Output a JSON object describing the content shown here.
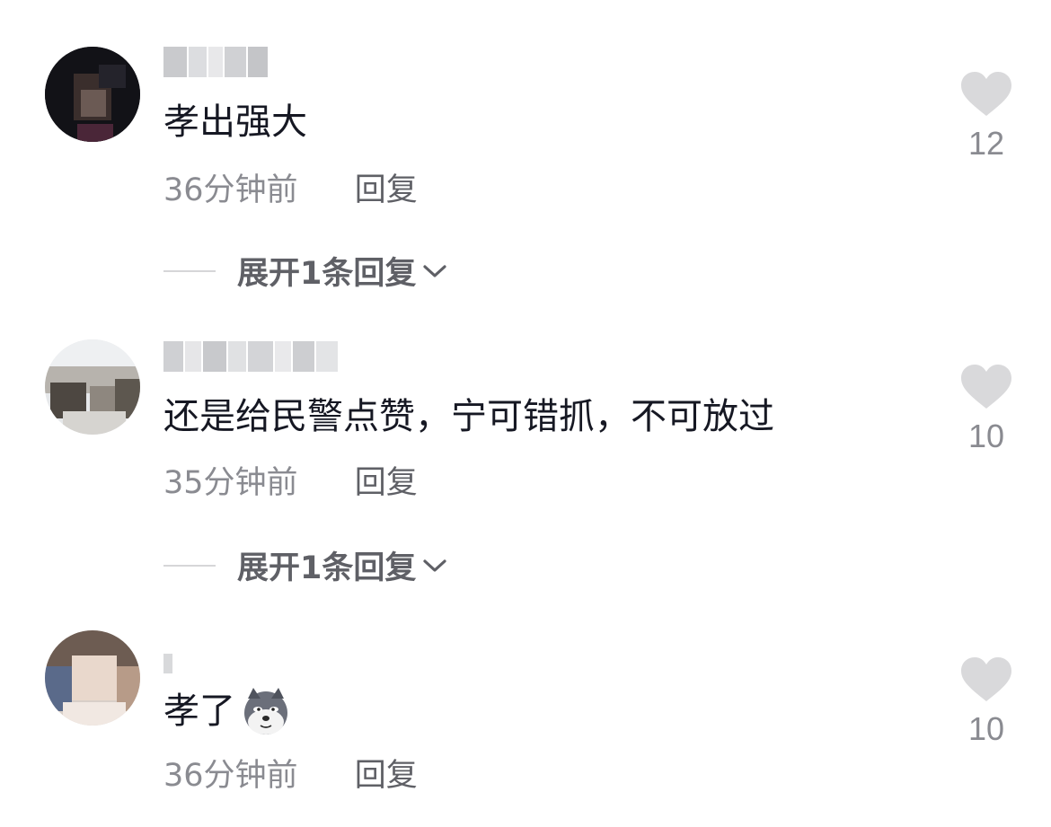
{
  "comments": [
    {
      "text": "孝出强大",
      "time": "36分钟前",
      "reply_label": "回复",
      "expand_label": "展开1条回复",
      "likes": "12",
      "has_emoji": false
    },
    {
      "text": "还是给民警点赞，宁可错抓，不可放过",
      "time": "35分钟前",
      "reply_label": "回复",
      "expand_label": "展开1条回复",
      "likes": "10",
      "has_emoji": false
    },
    {
      "text": "孝了",
      "time": "36分钟前",
      "reply_label": "回复",
      "likes": "10",
      "has_emoji": true,
      "emoji": "husky-dog-emoji"
    }
  ],
  "icons": {
    "like": "heart-icon",
    "expand": "chevron-down-icon"
  },
  "colors": {
    "text": "#161823",
    "meta": "#8a8b91",
    "heart": "#d9d9db"
  }
}
